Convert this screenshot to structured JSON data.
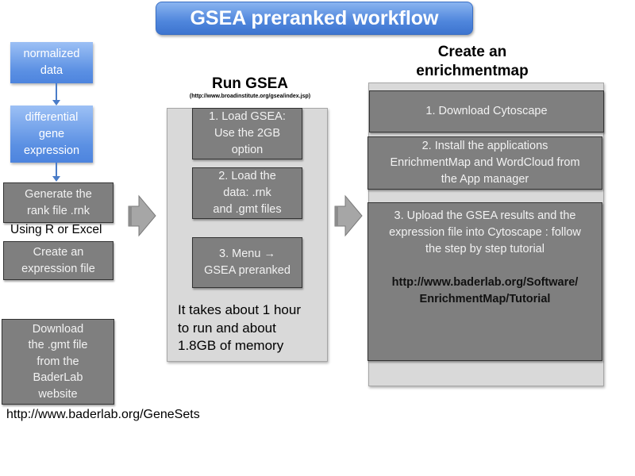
{
  "title": "GSEA preranked workflow",
  "left_column": {
    "steps_blue": [
      {
        "label": "normalized\ndata"
      },
      {
        "label": "differential\ngene\nexpression"
      }
    ],
    "generate_rank": "Generate the\nrank file .rnk",
    "tool_note": "Using R or Excel",
    "create_expression": "Create an\nexpression file",
    "download_gmt": "Download\nthe .gmt file\nfrom the\nBaderLab\nwebsite",
    "genesets_url": "http://www.baderlab.org/GeneSets"
  },
  "run_gsea": {
    "heading": "Run GSEA",
    "url": "(http://www.broadinstitute.org/gsea/index.jsp)",
    "steps": [
      {
        "label": "1. Load GSEA:\nUse the 2GB\noption"
      },
      {
        "label": "2. Load the\ndata: .rnk\nand .gmt files"
      },
      {
        "label": "3. Menu →\nGSEA preranked"
      }
    ],
    "note": "It takes about 1 hour\nto run and about\n1.8GB of memory"
  },
  "enrichment_map": {
    "heading": "Create an\nenrichmentmap",
    "steps": [
      {
        "label": "1. Download Cytoscape"
      },
      {
        "label": "2. Install the applications\nEnrichmentMap and WordCloud from\nthe App manager"
      },
      {
        "label": "3. Upload the GSEA results and the\nexpression file into Cytoscape : follow\nthe step by step tutorial"
      }
    ],
    "tutorial_url": "http://www.baderlab.org/Software/\nEnrichmentMap/Tutorial"
  },
  "icons": {
    "flow_arrow": "block-arrow-right",
    "down_arrow": "arrow-down"
  },
  "colors": {
    "title_blue": "#4f86dc",
    "step_blue": "#5b90e3",
    "step_dark": "#7f7f7f",
    "panel_gray": "#d9d9d9"
  }
}
